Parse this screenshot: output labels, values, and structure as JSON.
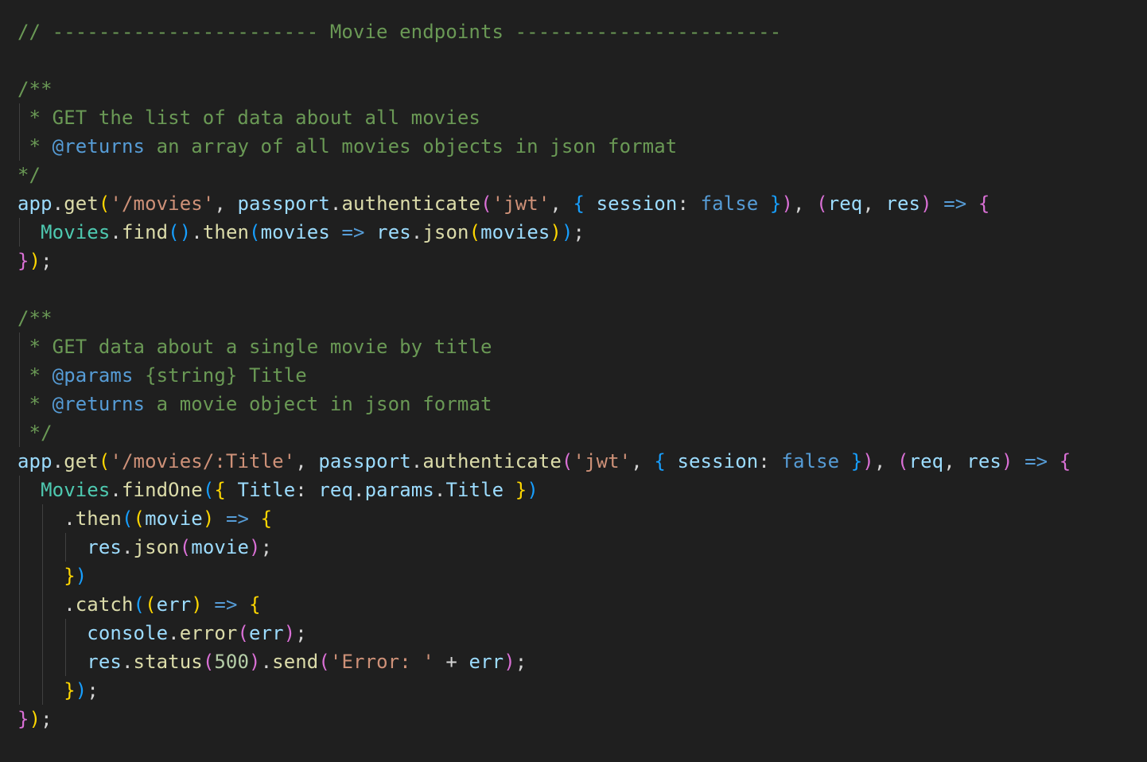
{
  "editor": {
    "colors": {
      "background": "#1f1f1f",
      "comment": "#6a9955",
      "jsdoc_tag": "#569cd6",
      "variable": "#9cdcfe",
      "function": "#dcdcaa",
      "string": "#ce9178",
      "number": "#b5cea8",
      "keyword": "#569cd6",
      "class": "#4ec9b0",
      "plain": "#d4d4d4",
      "bracket_level_1": "#ffd700",
      "bracket_level_2": "#da70d6",
      "bracket_level_3": "#179fff"
    },
    "lines": [
      [
        [
          "cm",
          "// ----------------------- Movie endpoints -----------------------"
        ]
      ],
      [],
      [
        [
          "cm",
          "/**"
        ]
      ],
      [
        [
          "cm",
          " * GET the list of data about all movies"
        ]
      ],
      [
        [
          "cm",
          " * "
        ],
        [
          "tag",
          "@returns"
        ],
        [
          "cm",
          " an array of all movies objects in json format"
        ]
      ],
      [
        [
          "cm",
          "*/"
        ]
      ],
      [
        [
          "var",
          "app"
        ],
        [
          "pl",
          "."
        ],
        [
          "fn",
          "get"
        ],
        [
          "b1",
          "("
        ],
        [
          "str",
          "'/movies'"
        ],
        [
          "pl",
          ", "
        ],
        [
          "var",
          "passport"
        ],
        [
          "pl",
          "."
        ],
        [
          "fn",
          "authenticate"
        ],
        [
          "b2",
          "("
        ],
        [
          "str",
          "'jwt'"
        ],
        [
          "pl",
          ", "
        ],
        [
          "b3",
          "{"
        ],
        [
          "pl",
          " "
        ],
        [
          "var",
          "session"
        ],
        [
          "pl",
          ": "
        ],
        [
          "kw",
          "false"
        ],
        [
          "pl",
          " "
        ],
        [
          "b3",
          "}"
        ],
        [
          "b2",
          ")"
        ],
        [
          "pl",
          ", "
        ],
        [
          "b2",
          "("
        ],
        [
          "var",
          "req"
        ],
        [
          "pl",
          ", "
        ],
        [
          "var",
          "res"
        ],
        [
          "b2",
          ")"
        ],
        [
          "pl",
          " "
        ],
        [
          "kw",
          "=>"
        ],
        [
          "pl",
          " "
        ],
        [
          "b2",
          "{"
        ]
      ],
      [
        [
          "pl",
          "  "
        ],
        [
          "cls",
          "Movies"
        ],
        [
          "pl",
          "."
        ],
        [
          "fn",
          "find"
        ],
        [
          "b3",
          "()"
        ],
        [
          "pl",
          "."
        ],
        [
          "fn",
          "then"
        ],
        [
          "b3",
          "("
        ],
        [
          "var",
          "movies"
        ],
        [
          "pl",
          " "
        ],
        [
          "kw",
          "=>"
        ],
        [
          "pl",
          " "
        ],
        [
          "var",
          "res"
        ],
        [
          "pl",
          "."
        ],
        [
          "fn",
          "json"
        ],
        [
          "b1",
          "("
        ],
        [
          "var",
          "movies"
        ],
        [
          "b1",
          ")"
        ],
        [
          "b3",
          ")"
        ],
        [
          "pl",
          ";"
        ]
      ],
      [
        [
          "b2",
          "}"
        ],
        [
          "b1",
          ")"
        ],
        [
          "pl",
          ";"
        ]
      ],
      [],
      [
        [
          "cm",
          "/**"
        ]
      ],
      [
        [
          "cm",
          " * GET data about a single movie by title"
        ]
      ],
      [
        [
          "cm",
          " * "
        ],
        [
          "tag",
          "@params"
        ],
        [
          "cm",
          " {string} Title"
        ]
      ],
      [
        [
          "cm",
          " * "
        ],
        [
          "tag",
          "@returns"
        ],
        [
          "cm",
          " a movie object in json format"
        ]
      ],
      [
        [
          "cm",
          " */"
        ]
      ],
      [
        [
          "var",
          "app"
        ],
        [
          "pl",
          "."
        ],
        [
          "fn",
          "get"
        ],
        [
          "b1",
          "("
        ],
        [
          "str",
          "'/movies/:Title'"
        ],
        [
          "pl",
          ", "
        ],
        [
          "var",
          "passport"
        ],
        [
          "pl",
          "."
        ],
        [
          "fn",
          "authenticate"
        ],
        [
          "b2",
          "("
        ],
        [
          "str",
          "'jwt'"
        ],
        [
          "pl",
          ", "
        ],
        [
          "b3",
          "{"
        ],
        [
          "pl",
          " "
        ],
        [
          "var",
          "session"
        ],
        [
          "pl",
          ": "
        ],
        [
          "kw",
          "false"
        ],
        [
          "pl",
          " "
        ],
        [
          "b3",
          "}"
        ],
        [
          "b2",
          ")"
        ],
        [
          "pl",
          ", "
        ],
        [
          "b2",
          "("
        ],
        [
          "var",
          "req"
        ],
        [
          "pl",
          ", "
        ],
        [
          "var",
          "res"
        ],
        [
          "b2",
          ")"
        ],
        [
          "pl",
          " "
        ],
        [
          "kw",
          "=>"
        ],
        [
          "pl",
          " "
        ],
        [
          "b2",
          "{"
        ]
      ],
      [
        [
          "pl",
          "  "
        ],
        [
          "cls",
          "Movies"
        ],
        [
          "pl",
          "."
        ],
        [
          "fn",
          "findOne"
        ],
        [
          "b3",
          "("
        ],
        [
          "b1",
          "{"
        ],
        [
          "pl",
          " "
        ],
        [
          "var",
          "Title"
        ],
        [
          "pl",
          ": "
        ],
        [
          "var",
          "req"
        ],
        [
          "pl",
          "."
        ],
        [
          "var",
          "params"
        ],
        [
          "pl",
          "."
        ],
        [
          "var",
          "Title"
        ],
        [
          "pl",
          " "
        ],
        [
          "b1",
          "}"
        ],
        [
          "b3",
          ")"
        ]
      ],
      [
        [
          "pl",
          "    ."
        ],
        [
          "fn",
          "then"
        ],
        [
          "b3",
          "("
        ],
        [
          "b1",
          "("
        ],
        [
          "var",
          "movie"
        ],
        [
          "b1",
          ")"
        ],
        [
          "pl",
          " "
        ],
        [
          "kw",
          "=>"
        ],
        [
          "pl",
          " "
        ],
        [
          "b1",
          "{"
        ]
      ],
      [
        [
          "pl",
          "      "
        ],
        [
          "var",
          "res"
        ],
        [
          "pl",
          "."
        ],
        [
          "fn",
          "json"
        ],
        [
          "b2",
          "("
        ],
        [
          "var",
          "movie"
        ],
        [
          "b2",
          ")"
        ],
        [
          "pl",
          ";"
        ]
      ],
      [
        [
          "pl",
          "    "
        ],
        [
          "b1",
          "}"
        ],
        [
          "b3",
          ")"
        ]
      ],
      [
        [
          "pl",
          "    ."
        ],
        [
          "fn",
          "catch"
        ],
        [
          "b3",
          "("
        ],
        [
          "b1",
          "("
        ],
        [
          "var",
          "err"
        ],
        [
          "b1",
          ")"
        ],
        [
          "pl",
          " "
        ],
        [
          "kw",
          "=>"
        ],
        [
          "pl",
          " "
        ],
        [
          "b1",
          "{"
        ]
      ],
      [
        [
          "pl",
          "      "
        ],
        [
          "var",
          "console"
        ],
        [
          "pl",
          "."
        ],
        [
          "fn",
          "error"
        ],
        [
          "b2",
          "("
        ],
        [
          "var",
          "err"
        ],
        [
          "b2",
          ")"
        ],
        [
          "pl",
          ";"
        ]
      ],
      [
        [
          "pl",
          "      "
        ],
        [
          "var",
          "res"
        ],
        [
          "pl",
          "."
        ],
        [
          "fn",
          "status"
        ],
        [
          "b2",
          "("
        ],
        [
          "num",
          "500"
        ],
        [
          "b2",
          ")"
        ],
        [
          "pl",
          "."
        ],
        [
          "fn",
          "send"
        ],
        [
          "b2",
          "("
        ],
        [
          "str",
          "'Error: '"
        ],
        [
          "pl",
          " + "
        ],
        [
          "var",
          "err"
        ],
        [
          "b2",
          ")"
        ],
        [
          "pl",
          ";"
        ]
      ],
      [
        [
          "pl",
          "    "
        ],
        [
          "b1",
          "}"
        ],
        [
          "b3",
          ")"
        ],
        [
          "pl",
          ";"
        ]
      ],
      [
        [
          "b2",
          "}"
        ],
        [
          "b1",
          ")"
        ],
        [
          "pl",
          ";"
        ]
      ]
    ]
  }
}
